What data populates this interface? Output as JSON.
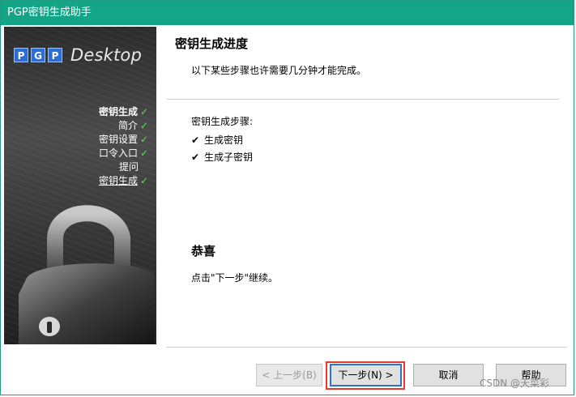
{
  "window": {
    "title": "PGP密钥生成助手"
  },
  "sidebar": {
    "logo": {
      "letters": [
        "P",
        "G",
        "P"
      ],
      "product": "Desktop"
    },
    "steps": [
      {
        "label": "密钥生成",
        "checked": true,
        "style": "bold"
      },
      {
        "label": "简介",
        "checked": true,
        "style": "normal"
      },
      {
        "label": "密钥设置",
        "checked": true,
        "style": "normal"
      },
      {
        "label": "口令入口",
        "checked": true,
        "style": "normal"
      },
      {
        "label": "提问",
        "checked": false,
        "style": "normal"
      },
      {
        "label": "密钥生成",
        "checked": true,
        "style": "link"
      }
    ],
    "check_glyph": "✓"
  },
  "main": {
    "title": "密钥生成进度",
    "subtitle": "以下某些步骤也许需要几分钟才能完成。",
    "steps_heading": "密钥生成步骤:",
    "steps": [
      {
        "check": "✔",
        "label": "生成密钥"
      },
      {
        "check": "✔",
        "label": "生成子密钥"
      }
    ],
    "congrats_title": "恭喜",
    "hint": "点击\"下一步\"继续。"
  },
  "buttons": {
    "back": "< 上一步(B)",
    "next": "下一步(N) >",
    "cancel": "取消",
    "help": "帮助"
  },
  "watermark": "CSDN @天菜彩",
  "colors": {
    "titlebar": "#14a587",
    "accent": "#2f73c9",
    "highlight": "#e53935",
    "check": "#4ee64a"
  }
}
